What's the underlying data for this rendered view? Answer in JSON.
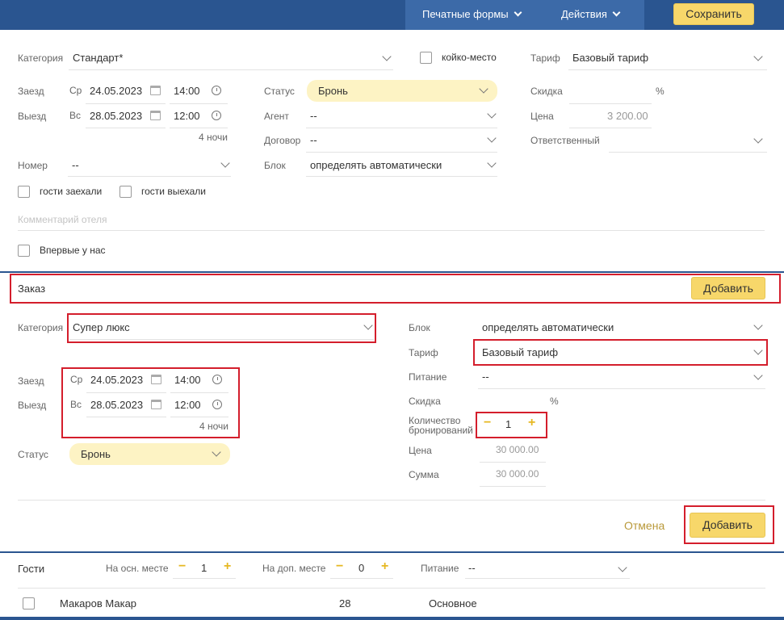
{
  "toolbar": {
    "print_forms": "Печатные формы",
    "actions": "Действия",
    "save": "Сохранить"
  },
  "booking": {
    "category_label": "Категория",
    "category_value": "Стандарт*",
    "bed_place_label": "койко-место",
    "tariff_label": "Тариф",
    "tariff_value": "Базовый тариф",
    "checkin_label": "Заезд",
    "checkin_day": "Ср",
    "checkin_date": "24.05.2023",
    "checkin_time": "14:00",
    "checkout_label": "Выезд",
    "checkout_day": "Вс",
    "checkout_date": "28.05.2023",
    "checkout_time": "12:00",
    "nights": "4 ночи",
    "status_label": "Статус",
    "status_value": "Бронь",
    "agent_label": "Агент",
    "agent_value": "--",
    "contract_label": "Договор",
    "contract_value": "--",
    "block_label": "Блок",
    "block_value": "определять автоматически",
    "discount_label": "Скидка",
    "discount_unit": "%",
    "price_label": "Цена",
    "price_value": "3 200.00",
    "responsible_label": "Ответственный",
    "room_label": "Номер",
    "room_value": "--",
    "guests_checked_in": "гости заехали",
    "guests_checked_out": "гости выехали",
    "comment_placeholder": "Комментарий отеля",
    "first_time": "Впервые у нас"
  },
  "order": {
    "title": "Заказ",
    "add_top": "Добавить",
    "category_label": "Категория",
    "category_value": "Супер люкс",
    "checkin_label": "Заезд",
    "checkin_day": "Ср",
    "checkin_date": "24.05.2023",
    "checkin_time": "14:00",
    "checkout_label": "Выезд",
    "checkout_day": "Вс",
    "checkout_date": "28.05.2023",
    "checkout_time": "12:00",
    "nights": "4 ночи",
    "status_label": "Статус",
    "status_value": "Бронь",
    "block_label": "Блок",
    "block_value": "определять автоматически",
    "tariff_label": "Тариф",
    "tariff_value": "Базовый тариф",
    "meal_label": "Питание",
    "meal_value": "--",
    "discount_label": "Скидка",
    "discount_unit": "%",
    "qty_label_1": "Количество",
    "qty_label_2": "бронирований",
    "qty_minus": "−",
    "qty_value": "1",
    "qty_plus": "+",
    "price_label": "Цена",
    "price_value": "30 000.00",
    "sum_label": "Сумма",
    "sum_value": "30 000.00",
    "cancel": "Отмена",
    "add_bottom": "Добавить"
  },
  "guests": {
    "title": "Гости",
    "main_place_label": "На осн. месте",
    "main_place_value": "1",
    "extra_place_label": "На доп. месте",
    "extra_place_value": "0",
    "meal_label": "Питание",
    "meal_value": "--",
    "minus": "−",
    "plus": "+",
    "rows": [
      {
        "name": "Макаров Макар",
        "age": "28",
        "place": "Основное"
      }
    ]
  }
}
